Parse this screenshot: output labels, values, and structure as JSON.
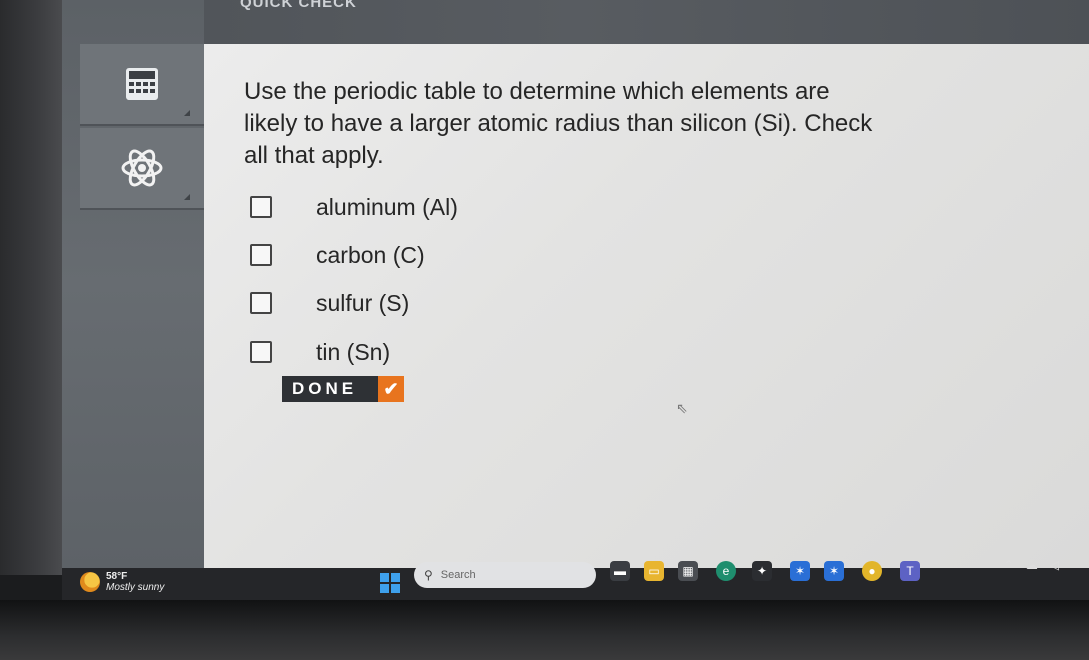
{
  "header": {
    "title": "QUICK CHECK"
  },
  "sidebar": {
    "items": [
      {
        "icon": "headphones-icon"
      },
      {
        "icon": "calculator-icon"
      },
      {
        "icon": "atom-icon"
      }
    ]
  },
  "question": {
    "prompt": "Use the periodic table to determine which elements are likely to have a larger atomic radius than silicon (Si). Check all that apply.",
    "options": [
      {
        "label": "aluminum (Al)",
        "checked": false
      },
      {
        "label": "carbon (C)",
        "checked": false
      },
      {
        "label": "sulfur (S)",
        "checked": false
      },
      {
        "label": "tin (Sn)",
        "checked": false
      }
    ],
    "done_label": "DONE"
  },
  "taskbar": {
    "weather": {
      "temp": "58°F",
      "condition": "Mostly sunny"
    },
    "search_placeholder": "Search"
  },
  "colors": {
    "accent": "#e8741e",
    "done_bg": "#2e3135",
    "start": "#3ea0ec"
  }
}
